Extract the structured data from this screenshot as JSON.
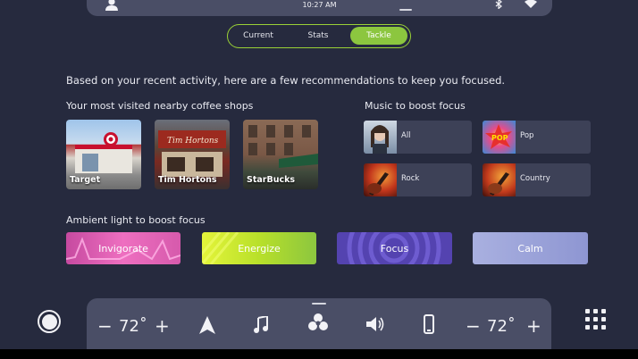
{
  "status_bar": {
    "time": "10:27 AM"
  },
  "tabs": [
    {
      "label": "Current",
      "active": false
    },
    {
      "label": "Stats",
      "active": false
    },
    {
      "label": "Tackle",
      "active": true
    }
  ],
  "headline": "Based on your recent activity, here are a few recommendations to keep you focused.",
  "coffee": {
    "title": "Your most visited nearby coffee shops",
    "shops": [
      {
        "label": "Target"
      },
      {
        "label": "Tim Hortons"
      },
      {
        "label": "StarBucks"
      }
    ]
  },
  "music": {
    "title": "Music to boost focus",
    "items": [
      {
        "label": "All"
      },
      {
        "label": "Pop"
      },
      {
        "label": "Rock"
      },
      {
        "label": "Country"
      }
    ]
  },
  "ambient": {
    "title": "Ambient light to boost focus",
    "items": [
      {
        "label": "Invigorate",
        "color": "#e05fb0"
      },
      {
        "label": "Energize",
        "color": "#b8e02a"
      },
      {
        "label": "Focus",
        "color": "#5a49b8"
      },
      {
        "label": "Calm",
        "color": "#9aa3d8"
      }
    ]
  },
  "dock": {
    "left_temp": "72˚",
    "right_temp": "72˚",
    "minus": "−",
    "plus": "+"
  },
  "colors": {
    "accent": "#8cc63f",
    "background": "#262a3e",
    "panel": "#4a4e66"
  },
  "icons": [
    "user-icon",
    "bluetooth-icon",
    "wifi-icon",
    "navigation-icon",
    "music-note-icon",
    "fan-icon",
    "volume-icon",
    "phone-icon",
    "home-icon",
    "apps-grid-icon"
  ]
}
